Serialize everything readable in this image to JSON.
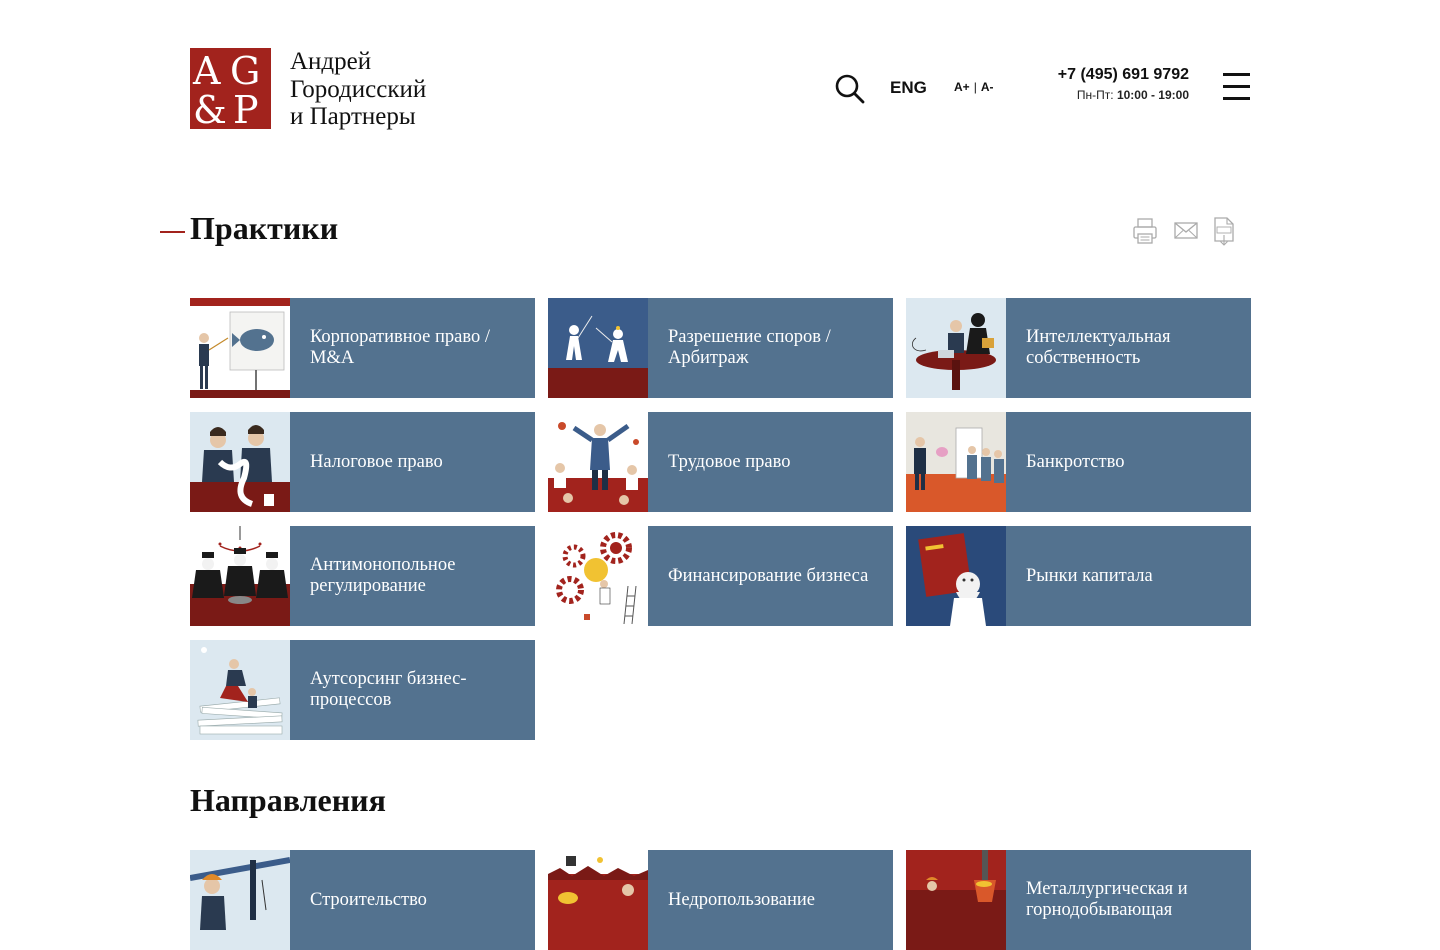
{
  "header": {
    "logo_letters": [
      "A",
      "G",
      "&",
      "P"
    ],
    "brand_lines": [
      "Андрей",
      "Городисский",
      "и Партнеры"
    ],
    "lang": "ENG",
    "font_increase": "A+",
    "font_separator": "|",
    "font_decrease": "A-",
    "phone": "+7 (495) 691 9792",
    "hours_label": "Пн-Пт:",
    "hours_value": "10:00 - 19:00"
  },
  "practices": {
    "title": "Практики",
    "items": [
      {
        "label": "Корпоративное право / M&A",
        "icon": "presentation-fish-illustration"
      },
      {
        "label": "Разрешение споров / Арбитраж",
        "icon": "fencing-duel-illustration"
      },
      {
        "label": "Интеллектуальная собственность",
        "icon": "laptop-table-illustration"
      },
      {
        "label": "Налоговое право",
        "icon": "tax-paper-illustration"
      },
      {
        "label": "Трудовое право",
        "icon": "workers-crowd-illustration"
      },
      {
        "label": "Банкротство",
        "icon": "piggy-bank-illustration"
      },
      {
        "label": "Антимонопольное регулирование",
        "icon": "chandelier-meeting-illustration"
      },
      {
        "label": "Финансирование бизнеса",
        "icon": "gears-coin-illustration"
      },
      {
        "label": "Рынки капитала",
        "icon": "das-kapital-illustration"
      },
      {
        "label": "Аутсорсинг бизнес-процессов",
        "icon": "paper-stack-illustration"
      }
    ]
  },
  "directions": {
    "title": "Направления",
    "items": [
      {
        "label": "Строительство",
        "icon": "crane-worker-illustration"
      },
      {
        "label": "Недропользование",
        "icon": "mining-illustration"
      },
      {
        "label": "Металлургическая и горнодобывающая",
        "icon": "metallurgy-illustration"
      }
    ]
  },
  "tools": [
    "print-icon",
    "email-icon",
    "pdf-icon"
  ],
  "colors": {
    "brand_red": "#a2231d",
    "tile_blue": "#53728f",
    "text": "#111111"
  }
}
